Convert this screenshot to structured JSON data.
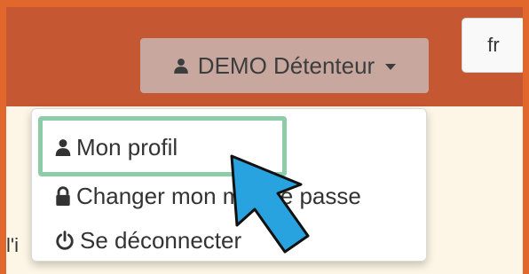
{
  "header": {
    "user_menu_label": "DEMO Détenteur",
    "language_label": "fr"
  },
  "background_text": "l'i",
  "dropdown": {
    "items": [
      {
        "label": "Mon profil",
        "icon": "user-icon"
      },
      {
        "label": "Changer mon mot de passe",
        "icon": "lock-icon"
      },
      {
        "label": "Se déconnecter",
        "icon": "power-icon"
      }
    ]
  },
  "annotation": {
    "highlight_color": "#8ccda7",
    "pointer_color": "#29a3e0"
  },
  "colors": {
    "outer_border": "#e2672c",
    "topbar": "#c55733",
    "user_button": "#c8a79f",
    "page_background": "#fdf6e6"
  }
}
